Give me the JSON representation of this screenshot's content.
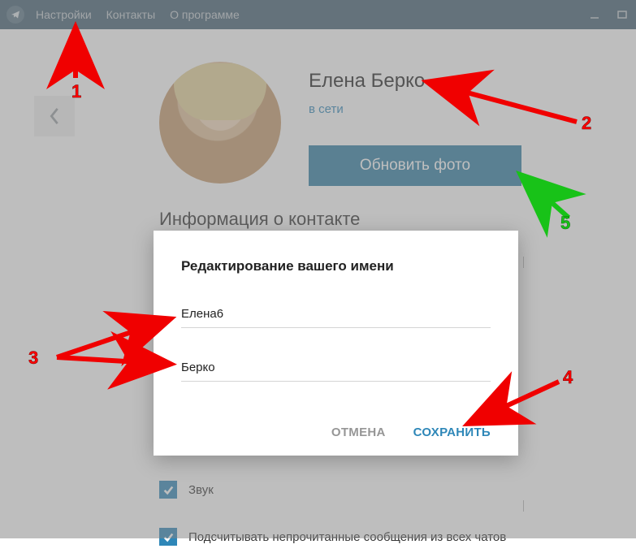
{
  "menubar": {
    "items": [
      "Настройки",
      "Контакты",
      "О программе"
    ]
  },
  "profile": {
    "name": "Елена Берко",
    "status": "в сети",
    "update_photo_label": "Обновить фото"
  },
  "section": {
    "contact_info_title": "Информация о контакте"
  },
  "dialog": {
    "title": "Редактирование вашего имени",
    "first_name_value": "Елена6",
    "last_name_value": "Берко",
    "cancel_label": "ОТМЕНА",
    "save_label": "СОХРАНИТЬ"
  },
  "settings": {
    "sound_label": "Звук",
    "count_unread_label": "Подсчитывать непрочитанные сообщения из всех чатов"
  },
  "annotations": {
    "n1": "1",
    "n2": "2",
    "n3": "3",
    "n4": "4",
    "n5": "5"
  },
  "colors": {
    "accent": "#2e87b8",
    "menubar_bg": "#446174",
    "arrow_red": "#f00000",
    "arrow_green": "#18c218"
  }
}
